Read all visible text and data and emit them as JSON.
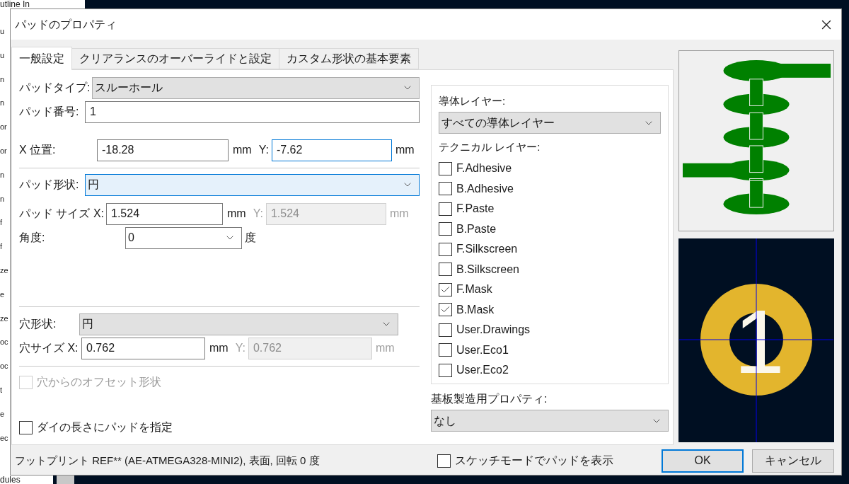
{
  "background_app": {
    "top_text": "utline In",
    "side_texts": [
      "u",
      "u",
      "n",
      "n",
      "or",
      "or",
      "n",
      "n",
      "f",
      "f",
      "ze",
      "e",
      "ze",
      "oc",
      "oc",
      "t",
      "e",
      "ec"
    ],
    "bottom_text": "dules"
  },
  "window": {
    "title": "パッドのプロパティ"
  },
  "tabs": [
    {
      "label": "一般設定",
      "selected": true
    },
    {
      "label": "クリアランスのオーバーライドと設定",
      "selected": false
    },
    {
      "label": "カスタム形状の基本要素",
      "selected": false
    }
  ],
  "pad_type": {
    "label": "パッドタイプ:",
    "value": "スルーホール"
  },
  "pad_number": {
    "label": "パッド番号:",
    "value": "1"
  },
  "position": {
    "x_label": "X 位置:",
    "x_value": "-18.28",
    "x_unit": "mm",
    "y_label": "Y:",
    "y_value": "-7.62",
    "y_focused": true,
    "y_unit": "mm"
  },
  "pad_shape": {
    "label": "パッド形状:",
    "value": "円",
    "highlighted": true
  },
  "pad_size": {
    "x_label": "パッド サイズ X:",
    "x_value": "1.524",
    "x_unit": "mm",
    "y_label": "Y:",
    "y_value": "1.524",
    "y_disabled": true,
    "y_unit": "mm"
  },
  "angle": {
    "label": "角度:",
    "value": "0",
    "unit": "度"
  },
  "hole_shape": {
    "label": "穴形状:",
    "value": "円"
  },
  "hole_size": {
    "x_label": "穴サイズ X:",
    "x_value": "0.762",
    "x_unit": "mm",
    "y_label": "Y:",
    "y_value": "0.762",
    "y_disabled": true,
    "y_unit": "mm"
  },
  "offset_shape": {
    "label": "穴からのオフセット形状",
    "checked": false,
    "disabled": true
  },
  "die_length": {
    "label": "ダイの長さにパッドを指定",
    "checked": false,
    "disabled": false
  },
  "copper_layers": {
    "label": "導体レイヤー:",
    "value": "すべての導体レイヤー"
  },
  "technical_layers": {
    "label": "テクニカル レイヤー:",
    "items": [
      {
        "label": "F.Adhesive",
        "checked": false
      },
      {
        "label": "B.Adhesive",
        "checked": false
      },
      {
        "label": "F.Paste",
        "checked": false
      },
      {
        "label": "B.Paste",
        "checked": false
      },
      {
        "label": "F.Silkscreen",
        "checked": false
      },
      {
        "label": "B.Silkscreen",
        "checked": false
      },
      {
        "label": "F.Mask",
        "checked": true
      },
      {
        "label": "B.Mask",
        "checked": true
      },
      {
        "label": "User.Drawings",
        "checked": false
      },
      {
        "label": "User.Eco1",
        "checked": false
      },
      {
        "label": "User.Eco2",
        "checked": false
      }
    ]
  },
  "fabrication": {
    "label": "基板製造用プロパティ:",
    "value": "なし"
  },
  "preview": {
    "pad_label": "1"
  },
  "status": "フットプリント REF** (AE-ATMEGA328-MINI2), 表面, 回転 0 度",
  "sketch_mode": {
    "label": "スケッチモードでパッドを表示",
    "checked": false,
    "disabled": false
  },
  "buttons": [
    {
      "label": "OK",
      "default": true
    },
    {
      "label": "キャンセル",
      "default": false
    }
  ]
}
